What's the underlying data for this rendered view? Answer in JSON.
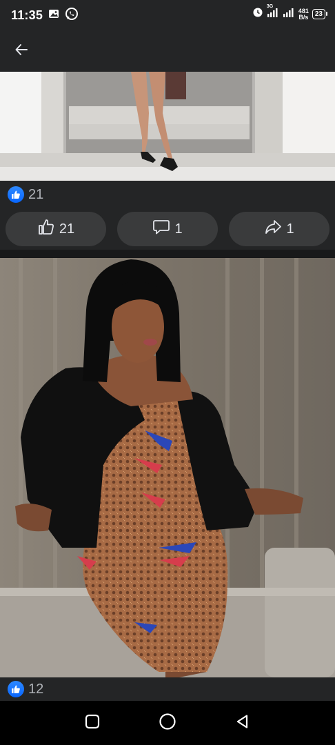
{
  "status_bar": {
    "time": "11:35",
    "network_type": "3G",
    "net_speed_value": "481",
    "net_speed_unit": "B/s",
    "battery": "23",
    "icons": [
      "image-icon",
      "whatsapp-icon",
      "alarm-icon",
      "signal-icon",
      "signal-icon"
    ]
  },
  "header": {
    "back_icon": "arrow-left-icon"
  },
  "post1": {
    "reaction_count": "21",
    "actions": {
      "like_count": "21",
      "comment_count": "1",
      "share_count": "1"
    }
  },
  "post2": {
    "reaction_count": "12"
  },
  "nav": {
    "icons": [
      "recents-icon",
      "home-icon",
      "back-icon"
    ]
  },
  "colors": {
    "accent": "#0866ff",
    "surface": "#242526",
    "button": "#3a3b3c"
  }
}
